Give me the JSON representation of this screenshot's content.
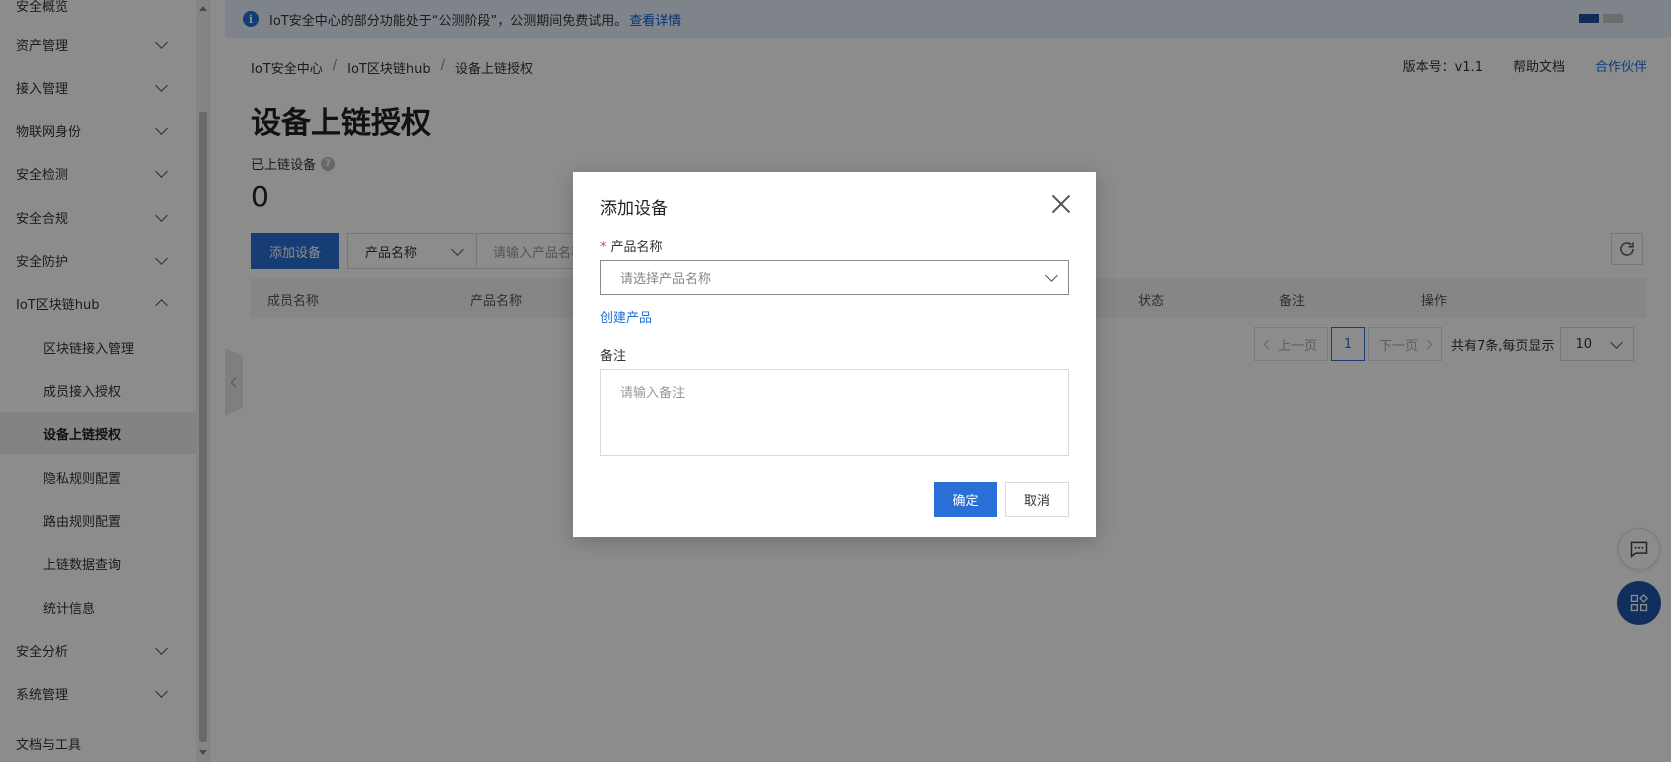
{
  "sidebar": {
    "items": [
      {
        "label": "安全概览"
      },
      {
        "label": "资产管理"
      },
      {
        "label": "接入管理"
      },
      {
        "label": "物联网身份"
      },
      {
        "label": "安全检测"
      },
      {
        "label": "安全合规"
      },
      {
        "label": "安全防护"
      },
      {
        "label": "IoT区块链hub"
      },
      {
        "label": "区块链接入管理"
      },
      {
        "label": "成员接入授权"
      },
      {
        "label": "设备上链授权"
      },
      {
        "label": "隐私规则配置"
      },
      {
        "label": "路由规则配置"
      },
      {
        "label": "上链数据查询"
      },
      {
        "label": "统计信息"
      },
      {
        "label": "安全分析"
      },
      {
        "label": "系统管理"
      },
      {
        "label": "文档与工具"
      }
    ]
  },
  "notice": {
    "text": "IoT安全中心的部分功能处于“公测阶段”，公测期间免费试用。",
    "link": "查看详情"
  },
  "breadcrumb": [
    "IoT安全中心",
    "IoT区块链hub",
    "设备上链授权"
  ],
  "top_links": {
    "version": "版本号：v1.1",
    "help": "帮助文档",
    "partner": "合作伙伴"
  },
  "page": {
    "title": "设备上链授权",
    "stat_label": "已上链设备",
    "stat_value": "0"
  },
  "toolbar": {
    "add_label": "添加设备",
    "filter_select": "产品名称",
    "filter_placeholder": "请输入产品名称"
  },
  "table": {
    "columns": [
      "成员名称",
      "产品名称",
      "状态",
      "备注",
      "操作"
    ]
  },
  "pager": {
    "prev": "上一页",
    "current": "1",
    "next": "下一页",
    "total": "共有7条,每页显示",
    "page_size": "10"
  },
  "modal": {
    "title": "添加设备",
    "product_label": "产品名称",
    "required_mark": "*",
    "product_placeholder": "请选择产品名称",
    "create_link": "创建产品",
    "note_label": "备注",
    "note_placeholder": "请输入备注",
    "ok_label": "确定",
    "cancel_label": "取消"
  },
  "colors": {
    "primary": "#2a6fd6",
    "link": "#1e6fd9",
    "notice_bg": "#e7f1fb",
    "required": "#e0463b"
  }
}
